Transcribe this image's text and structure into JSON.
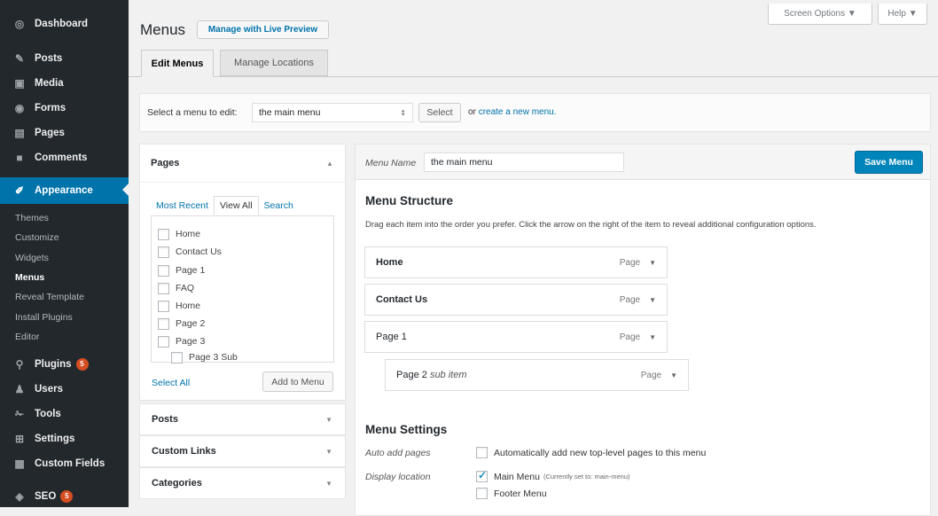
{
  "sidebar": {
    "items": [
      {
        "label": "Dashboard",
        "icon": "dashboard-icon",
        "glyph": "◎"
      },
      {
        "label": "Posts",
        "icon": "pin-icon",
        "glyph": "✎"
      },
      {
        "label": "Media",
        "icon": "media-icon",
        "glyph": "▣"
      },
      {
        "label": "Forms",
        "icon": "forms-icon",
        "glyph": "◉"
      },
      {
        "label": "Pages",
        "icon": "pages-icon",
        "glyph": "▤"
      },
      {
        "label": "Comments",
        "icon": "comments-icon",
        "glyph": "■"
      },
      {
        "label": "Appearance",
        "icon": "appearance-icon",
        "glyph": "✐"
      },
      {
        "label": "Plugins",
        "icon": "plugins-icon",
        "glyph": "⚲",
        "badge": "5"
      },
      {
        "label": "Users",
        "icon": "users-icon",
        "glyph": "♟"
      },
      {
        "label": "Tools",
        "icon": "tools-icon",
        "glyph": "✁"
      },
      {
        "label": "Settings",
        "icon": "settings-icon",
        "glyph": "⊞"
      },
      {
        "label": "Custom Fields",
        "icon": "custom-fields-icon",
        "glyph": "▦"
      },
      {
        "label": "SEO",
        "icon": "seo-icon",
        "glyph": "◈",
        "badge": "5"
      }
    ],
    "submenu": [
      "Themes",
      "Customize",
      "Widgets",
      "Menus",
      "Reveal Template",
      "Install Plugins",
      "Editor"
    ]
  },
  "header": {
    "title": "Menus",
    "live_preview": "Manage with Live Preview",
    "screen_options": "Screen Options ▼",
    "help": "Help ▼"
  },
  "tabs": [
    "Edit Menus",
    "Manage Locations"
  ],
  "select_bar": {
    "label": "Select a menu to edit:",
    "value": "the main menu",
    "button": "Select",
    "or_text": "or",
    "create_link": "create a new menu."
  },
  "pages_box": {
    "title": "Pages",
    "tabs": [
      "Most Recent",
      "View All",
      "Search"
    ],
    "items": [
      "Home",
      "Contact Us",
      "Page 1",
      "FAQ",
      "Home",
      "Page 2",
      "Page 3",
      "Page 3 Sub"
    ],
    "select_all": "Select All",
    "add_button": "Add to Menu"
  },
  "accordions": [
    "Posts",
    "Custom Links",
    "Categories"
  ],
  "menu_edit": {
    "name_label": "Menu Name",
    "name_value": "the main menu",
    "save_button": "Save Menu",
    "structure_title": "Menu Structure",
    "structure_hint": "Drag each item into the order you prefer. Click the arrow on the right of the item to reveal additional configuration options.",
    "items": [
      {
        "title": "Home",
        "type": "Page",
        "bold": true
      },
      {
        "title": "Contact Us",
        "type": "Page",
        "bold": true
      },
      {
        "title": "Page 1",
        "type": "Page",
        "bold": false
      },
      {
        "title": "Page 2",
        "sub": "sub item",
        "type": "Page",
        "bold": false
      }
    ],
    "settings_title": "Menu Settings",
    "auto_add_label": "Auto add pages",
    "auto_add_text": "Automatically add new top-level pages to this menu",
    "display_label": "Display location",
    "main_menu": "Main Menu",
    "main_menu_note": "(Currently set to: main-menu)",
    "footer_menu": "Footer Menu"
  },
  "colors": {
    "sidebar": "#23282d",
    "accent": "#0073aa",
    "badge": "#d54e21"
  }
}
